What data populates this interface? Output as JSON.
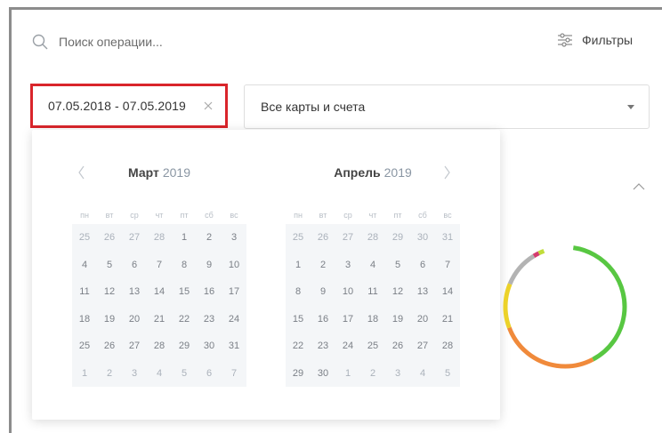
{
  "search": {
    "placeholder": "Поиск операции..."
  },
  "filters": {
    "label": "Фильтры"
  },
  "date_range": {
    "value": "07.05.2018 - 07.05.2019"
  },
  "cards_select": {
    "selected": "Все карты и счета"
  },
  "calendar": {
    "weekdays": [
      "пн",
      "вт",
      "ср",
      "чт",
      "пт",
      "сб",
      "вс"
    ],
    "left": {
      "month": "Март",
      "year": "2019",
      "days": [
        "25",
        "26",
        "27",
        "28",
        "1",
        "2",
        "3",
        "4",
        "5",
        "6",
        "7",
        "8",
        "9",
        "10",
        "11",
        "12",
        "13",
        "14",
        "15",
        "16",
        "17",
        "18",
        "19",
        "20",
        "21",
        "22",
        "23",
        "24",
        "25",
        "26",
        "27",
        "28",
        "29",
        "30",
        "31",
        "1",
        "2",
        "3",
        "4",
        "5",
        "6",
        "7"
      ]
    },
    "right": {
      "month": "Апрель",
      "year": "2019",
      "days": [
        "25",
        "26",
        "27",
        "28",
        "29",
        "30",
        "31",
        "1",
        "2",
        "3",
        "4",
        "5",
        "6",
        "7",
        "8",
        "9",
        "10",
        "11",
        "12",
        "13",
        "14",
        "15",
        "16",
        "17",
        "18",
        "19",
        "20",
        "21",
        "22",
        "23",
        "24",
        "25",
        "26",
        "27",
        "28",
        "29",
        "30",
        "1",
        "2",
        "3",
        "4",
        "5"
      ]
    }
  },
  "donut_segments": [
    {
      "color": "#58c742",
      "fraction": 0.4
    },
    {
      "color": "#f08a3b",
      "fraction": 0.27
    },
    {
      "color": "#ecd229",
      "fraction": 0.12
    },
    {
      "color": "#b3b3b3",
      "fraction": 0.1
    },
    {
      "color": "#d43c6e",
      "fraction": 0.015
    },
    {
      "color": "#c1dd3a",
      "fraction": 0.015
    }
  ]
}
